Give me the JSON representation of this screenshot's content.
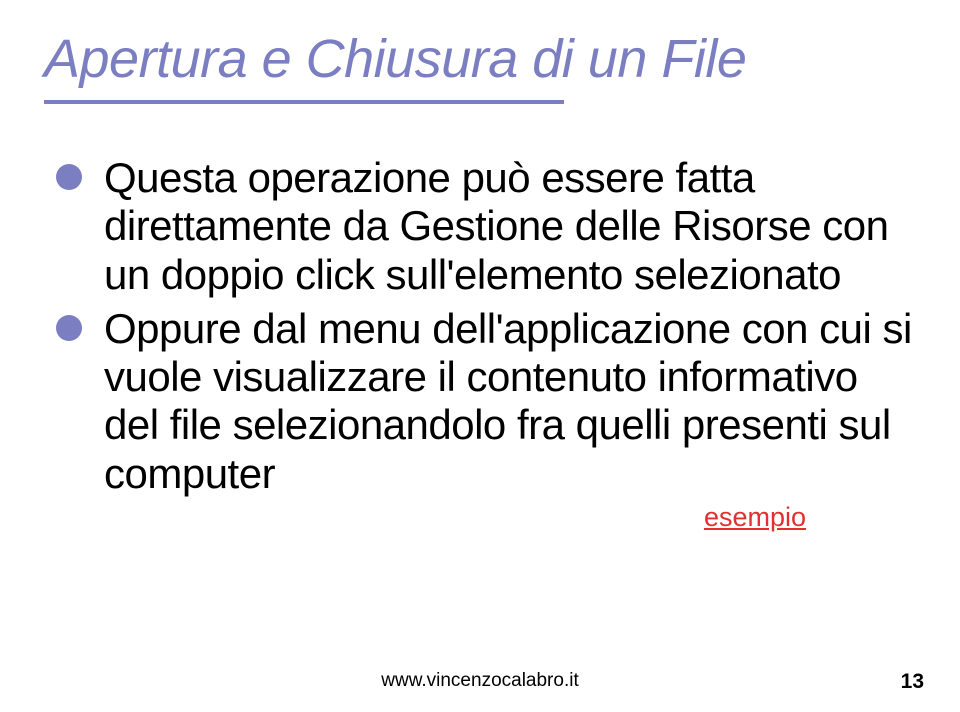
{
  "title": "Apertura e Chiusura di un File",
  "bullets": [
    "Questa operazione può essere fatta direttamente da Gestione delle Risorse con un doppio click sull'elemento selezionato",
    "Oppure dal menu dell'applicazione con cui si vuole visualizzare il contenuto informativo del file selezionandolo fra quelli presenti sul computer"
  ],
  "esempio_label": "esempio",
  "footer_url": "www.vincenzocalabro.it",
  "page_number": "13"
}
